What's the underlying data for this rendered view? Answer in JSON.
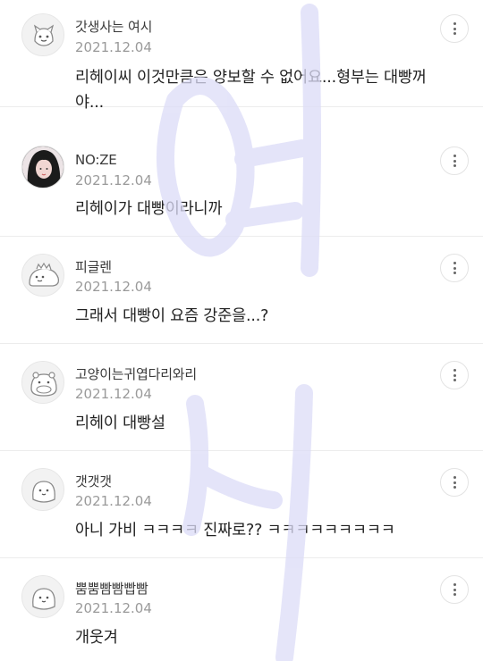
{
  "comments": [
    {
      "nickname": "갓생사는 여시",
      "date": "2021.12.04",
      "text": "리헤이씨 이것만큼은 양보할 수 없어요...형부는 대빵꺼야...",
      "avatar": "fox-face-icon"
    },
    {
      "nickname": "NO:ZE",
      "date": "2021.12.04",
      "text": "리헤이가 대빵이라니까",
      "avatar": "user-photo"
    },
    {
      "nickname": "피글렌",
      "date": "2021.12.04",
      "text": "그래서 대빵이 요즘 강준을...?",
      "avatar": "dinosaur-icon"
    },
    {
      "nickname": "고양이는귀엽다리와리",
      "date": "2021.12.04",
      "text": "리헤이 대빵설",
      "avatar": "hippo-icon"
    },
    {
      "nickname": "갯갯갯",
      "date": "2021.12.04",
      "text": "아니 가비 ㅋㅋㅋㅋ 진짜로?? ㅋㅋㅋㅋㅋㅋㅋㅋㅋ",
      "avatar": "blob-face-icon"
    },
    {
      "nickname": "뿜뿜빰빰빱빰",
      "date": "2021.12.04",
      "text": "개웃겨",
      "avatar": "blob-face-icon"
    }
  ],
  "colors": {
    "watermark": "#d8d8f5",
    "divider": "#ececec",
    "date": "#9a9a9a"
  }
}
